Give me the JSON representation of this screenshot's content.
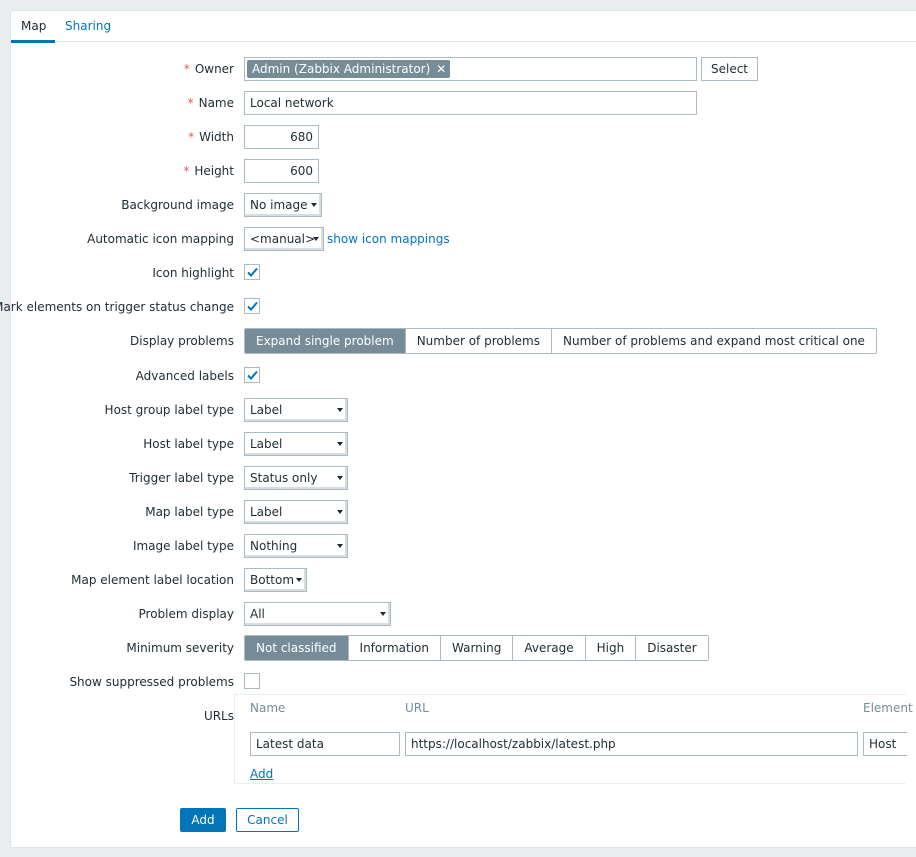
{
  "tabs": {
    "map": "Map",
    "sharing": "Sharing"
  },
  "required_marker": "*",
  "form": {
    "owner": {
      "label": "Owner",
      "chip": "Admin (Zabbix Administrator)",
      "chip_remove": "✕",
      "select_button": "Select"
    },
    "name": {
      "label": "Name",
      "value": "Local network"
    },
    "width": {
      "label": "Width",
      "value": "680"
    },
    "height": {
      "label": "Height",
      "value": "600"
    },
    "background_image": {
      "label": "Background image",
      "value": "No image"
    },
    "icon_mapping": {
      "label": "Automatic icon mapping",
      "value": "<manual>",
      "link": "show icon mappings"
    },
    "icon_highlight": {
      "label": "Icon highlight",
      "checked": true
    },
    "mark_elements": {
      "label": "Mark elements on trigger status change",
      "checked": true
    },
    "display_problems": {
      "label": "Display problems",
      "options": [
        "Expand single problem",
        "Number of problems",
        "Number of problems and expand most critical one"
      ],
      "selected": "Expand single problem"
    },
    "advanced_labels": {
      "label": "Advanced labels",
      "checked": true
    },
    "host_group_label_type": {
      "label": "Host group label type",
      "value": "Label"
    },
    "host_label_type": {
      "label": "Host label type",
      "value": "Label"
    },
    "trigger_label_type": {
      "label": "Trigger label type",
      "value": "Status only"
    },
    "map_label_type": {
      "label": "Map label type",
      "value": "Label"
    },
    "image_label_type": {
      "label": "Image label type",
      "value": "Nothing"
    },
    "element_label_location": {
      "label": "Map element label location",
      "value": "Bottom"
    },
    "problem_display": {
      "label": "Problem display",
      "value": "All"
    },
    "minimum_severity": {
      "label": "Minimum severity",
      "options": [
        "Not classified",
        "Information",
        "Warning",
        "Average",
        "High",
        "Disaster"
      ],
      "selected": "Not classified"
    },
    "show_suppressed": {
      "label": "Show suppressed problems",
      "checked": false
    },
    "urls": {
      "label": "URLs",
      "headers": {
        "name": "Name",
        "url": "URL",
        "element": "Element"
      },
      "rows": [
        {
          "name": "Latest data",
          "url": "https://localhost/zabbix/latest.php",
          "element": "Host"
        }
      ],
      "add_link": "Add"
    }
  },
  "actions": {
    "add": "Add",
    "cancel": "Cancel"
  },
  "colors": {
    "accent": "#0275b8",
    "active_segment": "#768d99",
    "required": "#e45959"
  }
}
